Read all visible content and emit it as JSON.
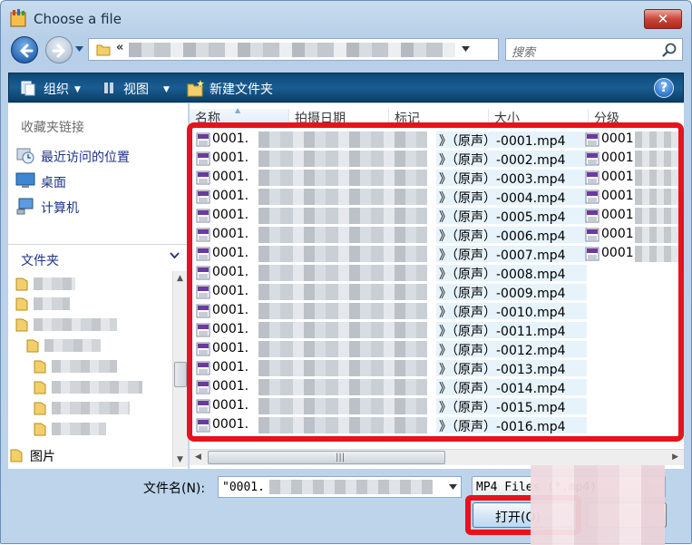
{
  "window": {
    "title": "Choose a file"
  },
  "address": {
    "chevron": "«",
    "refresh": "↻"
  },
  "search": {
    "placeholder": "搜索"
  },
  "toolbar": {
    "organize": "组织",
    "views": "视图",
    "new_folder": "新建文件夹",
    "help": "?"
  },
  "favorites": {
    "header": "收藏夹链接",
    "items": [
      {
        "label": "最近访问的位置",
        "icon": "recent-places-icon"
      },
      {
        "label": "桌面",
        "icon": "desktop-icon"
      },
      {
        "label": "计算机",
        "icon": "computer-icon"
      }
    ]
  },
  "folders": {
    "header": "文件夹",
    "last_item": "图片"
  },
  "columns": [
    {
      "label": "名称"
    },
    {
      "label": "拍摄日期"
    },
    {
      "label": "标记"
    },
    {
      "label": "大小"
    },
    {
      "label": "分级"
    }
  ],
  "files": [
    {
      "prefix": "0001.",
      "suffix": "》（原声）-0001.mp4"
    },
    {
      "prefix": "0001.",
      "suffix": "》（原声）-0002.mp4"
    },
    {
      "prefix": "0001.",
      "suffix": "》（原声）-0003.mp4"
    },
    {
      "prefix": "0001.",
      "suffix": "》（原声）-0004.mp4"
    },
    {
      "prefix": "0001.",
      "suffix": "》（原声）-0005.mp4"
    },
    {
      "prefix": "0001.",
      "suffix": "》（原声）-0006.mp4"
    },
    {
      "prefix": "0001.",
      "suffix": "》（原声）-0007.mp4"
    },
    {
      "prefix": "0001.",
      "suffix": "》（原声）-0008.mp4"
    },
    {
      "prefix": "0001.",
      "suffix": "》（原声）-0009.mp4"
    },
    {
      "prefix": "0001.",
      "suffix": "》（原声）-0010.mp4"
    },
    {
      "prefix": "0001.",
      "suffix": "》（原声）-0011.mp4"
    },
    {
      "prefix": "0001.",
      "suffix": "》（原声）-0012.mp4"
    },
    {
      "prefix": "0001.",
      "suffix": "》（原声）-0013.mp4"
    },
    {
      "prefix": "0001.",
      "suffix": "》（原声）-0014.mp4"
    },
    {
      "prefix": "0001.",
      "suffix": "》（原声）-0015.mp4"
    },
    {
      "prefix": "0001.",
      "suffix": "》（原声）-0016.mp4"
    }
  ],
  "files_col2": [
    {
      "prefix": "0001."
    },
    {
      "prefix": "0001."
    },
    {
      "prefix": "0001."
    },
    {
      "prefix": "0001."
    },
    {
      "prefix": "0001."
    },
    {
      "prefix": "0001."
    },
    {
      "prefix": "0001."
    }
  ],
  "bottom": {
    "filename_label": "文件名(N):",
    "filename_value": "\"0001.",
    "filetype_value": "MP4 Files (*.mp4)",
    "open_label": "打开(O)"
  },
  "colors": {
    "highlight": "#e8121c",
    "toolbar": "#1a5d92",
    "selection": "#e7f3fb"
  }
}
